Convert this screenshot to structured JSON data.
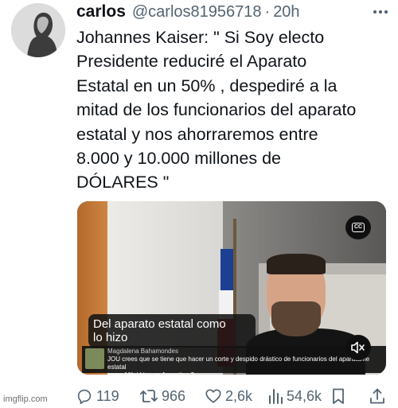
{
  "tweet": {
    "author_name": "carlos",
    "handle": "@carlos81956718",
    "separator": "·",
    "time": "20h",
    "text": "Johannes Kaiser: \" Si Soy electo\nPresidente reduciré el Aparato\nEstatal en un 50% , despediré a la\nmitad de los funcionarios del aparato\nestatal y nos ahorraremos entre\n8.000 y 10.000 millones de\nDÓLARES \""
  },
  "video": {
    "cc_label": "CC",
    "caption": "Del aparato estatal como\nlo hizo",
    "comment_author": "Magdalena Bahamondes",
    "comment_text": "JOU crees que se tiene que hacer un corte y despido drástico de funcionarios del aparatame estatal\ncomo Milei hizo en Argentina ?"
  },
  "actions": {
    "replies": "119",
    "retweets": "966",
    "likes": "2,6k",
    "views": "54,6k"
  },
  "watermark": "imgflip.com",
  "icons": {
    "more": "more-dots-icon",
    "reply": "reply-icon",
    "retweet": "retweet-icon",
    "like": "heart-icon",
    "views": "views-icon",
    "bookmark": "bookmark-icon",
    "share": "share-icon",
    "cc": "closed-captions-icon",
    "mute": "muted-speaker-icon"
  },
  "colors": {
    "text": "#0f1419",
    "secondary": "#536471",
    "flag_red": "#c8202b",
    "flag_blue": "#1c3f94"
  }
}
